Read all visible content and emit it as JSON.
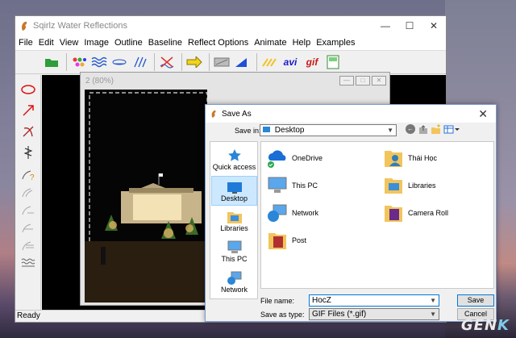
{
  "app": {
    "title": "Sqirlz Water Reflections",
    "menu": [
      "File",
      "Edit",
      "View",
      "Image",
      "Outline",
      "Baseline",
      "Reflect Options",
      "Animate",
      "Help",
      "Examples"
    ],
    "toolbar": {
      "avi_label": "avi",
      "gif_label": "gif"
    },
    "status": "Ready"
  },
  "child_window": {
    "title": "2  (80%)"
  },
  "dialog": {
    "title": "Save As",
    "save_in_label": "Save in:",
    "save_in_value": "Desktop",
    "places": [
      "Quick access",
      "Desktop",
      "Libraries",
      "This PC",
      "Network"
    ],
    "items": [
      "OneDrive",
      "Thái Học",
      "This PC",
      "Libraries",
      "Network",
      "Camera Roll",
      "Post"
    ],
    "file_name_label": "File name:",
    "file_name_value": "HocZ",
    "save_type_label": "Save as type:",
    "save_type_value": "GIF Files (*.gif)",
    "save_button": "Save",
    "cancel_button": "Cancel"
  },
  "watermark": {
    "prefix": "GEN",
    "suffix": "K"
  },
  "colors": {
    "accent": "#0078d7",
    "selection": "#cce8ff",
    "folder": "#f2c55c"
  }
}
